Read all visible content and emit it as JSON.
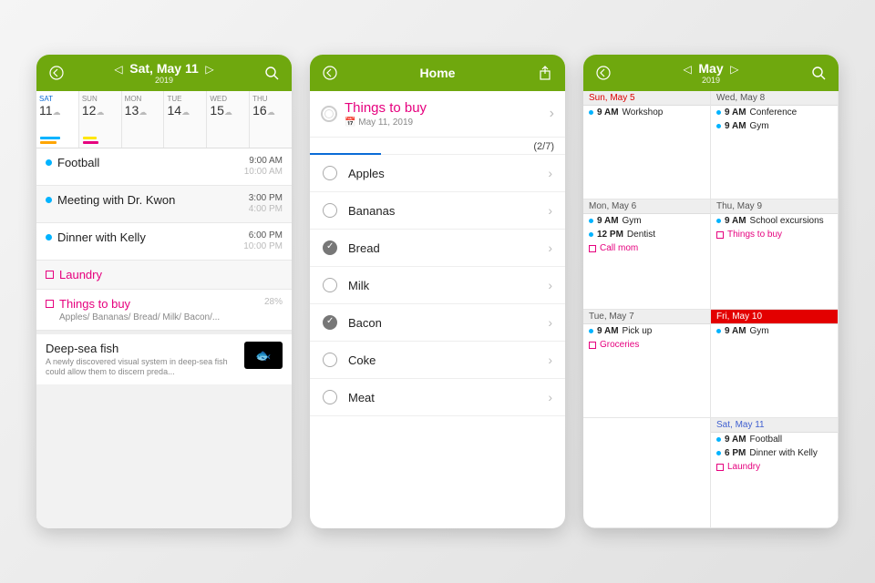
{
  "phone1": {
    "title": "Sat, May 11",
    "subtitle": "2019",
    "days": [
      {
        "dow": "SAT",
        "num": "11",
        "selected": true,
        "bars": [
          "#00b3ff",
          "#ffa500"
        ]
      },
      {
        "dow": "SUN",
        "num": "12",
        "bars": [
          "#ffe600",
          "#e6007e"
        ]
      },
      {
        "dow": "MON",
        "num": "13"
      },
      {
        "dow": "TUE",
        "num": "14"
      },
      {
        "dow": "WED",
        "num": "15"
      },
      {
        "dow": "THU",
        "num": "16"
      }
    ],
    "events": [
      {
        "title": "Football",
        "start": "9:00 AM",
        "end": "10:00 AM",
        "type": "event"
      },
      {
        "title": "Meeting with Dr. Kwon",
        "start": "3:00 PM",
        "end": "4:00 PM",
        "type": "event"
      },
      {
        "title": "Dinner with Kelly",
        "start": "6:00 PM",
        "end": "10:00 PM",
        "type": "event"
      },
      {
        "title": "Laundry",
        "type": "todo"
      },
      {
        "title": "Things to buy",
        "type": "todo",
        "sub": "Apples/ Bananas/ Bread/ Milk/ Bacon/...",
        "pct": "28%"
      }
    ],
    "article": {
      "title": "Deep-sea fish",
      "body": "A newly discovered visual system in deep-sea fish could allow them to discern preda..."
    }
  },
  "phone2": {
    "title": "Home",
    "list_title": "Things to buy",
    "list_date": "May 11, 2019",
    "progress": "(2/7)",
    "progress_pct": 28,
    "items": [
      {
        "label": "Apples",
        "done": false
      },
      {
        "label": "Bananas",
        "done": false
      },
      {
        "label": "Bread",
        "done": true
      },
      {
        "label": "Milk",
        "done": false
      },
      {
        "label": "Bacon",
        "done": true
      },
      {
        "label": "Coke",
        "done": false
      },
      {
        "label": "Meat",
        "done": false
      }
    ]
  },
  "phone3": {
    "title": "May",
    "subtitle": "2019",
    "cells": [
      {
        "head": "Sun, May 5",
        "cls": "sunday",
        "items": [
          {
            "time": "9 AM",
            "text": "Workshop"
          }
        ]
      },
      {
        "head": "Wed, May 8",
        "items": [
          {
            "time": "9 AM",
            "text": "Conference"
          },
          {
            "time": "9 AM",
            "text": "Gym"
          }
        ]
      },
      {
        "head": "Mon, May 6",
        "items": [
          {
            "time": "9 AM",
            "text": "Gym"
          },
          {
            "time": "12 PM",
            "text": "Dentist"
          },
          {
            "todo": true,
            "text": "Call mom"
          }
        ]
      },
      {
        "head": "Thu, May 9",
        "items": [
          {
            "time": "9 AM",
            "text": "School excursions"
          },
          {
            "todo": true,
            "text": "Things to buy"
          }
        ]
      },
      {
        "head": "Tue, May 7",
        "items": [
          {
            "time": "9 AM",
            "text": "Pick up"
          },
          {
            "todo": true,
            "text": "Groceries"
          }
        ]
      },
      {
        "head": "Fri, May 10",
        "cls": "today",
        "items": [
          {
            "time": "9 AM",
            "text": "Gym"
          }
        ]
      },
      {
        "head": "",
        "blank": true
      },
      {
        "head": "Sat, May 11",
        "cls": "saturday",
        "items": [
          {
            "time": "9 AM",
            "text": "Football"
          },
          {
            "time": "6 PM",
            "text": "Dinner with Kelly"
          },
          {
            "todo": true,
            "text": "Laundry"
          }
        ]
      }
    ]
  }
}
